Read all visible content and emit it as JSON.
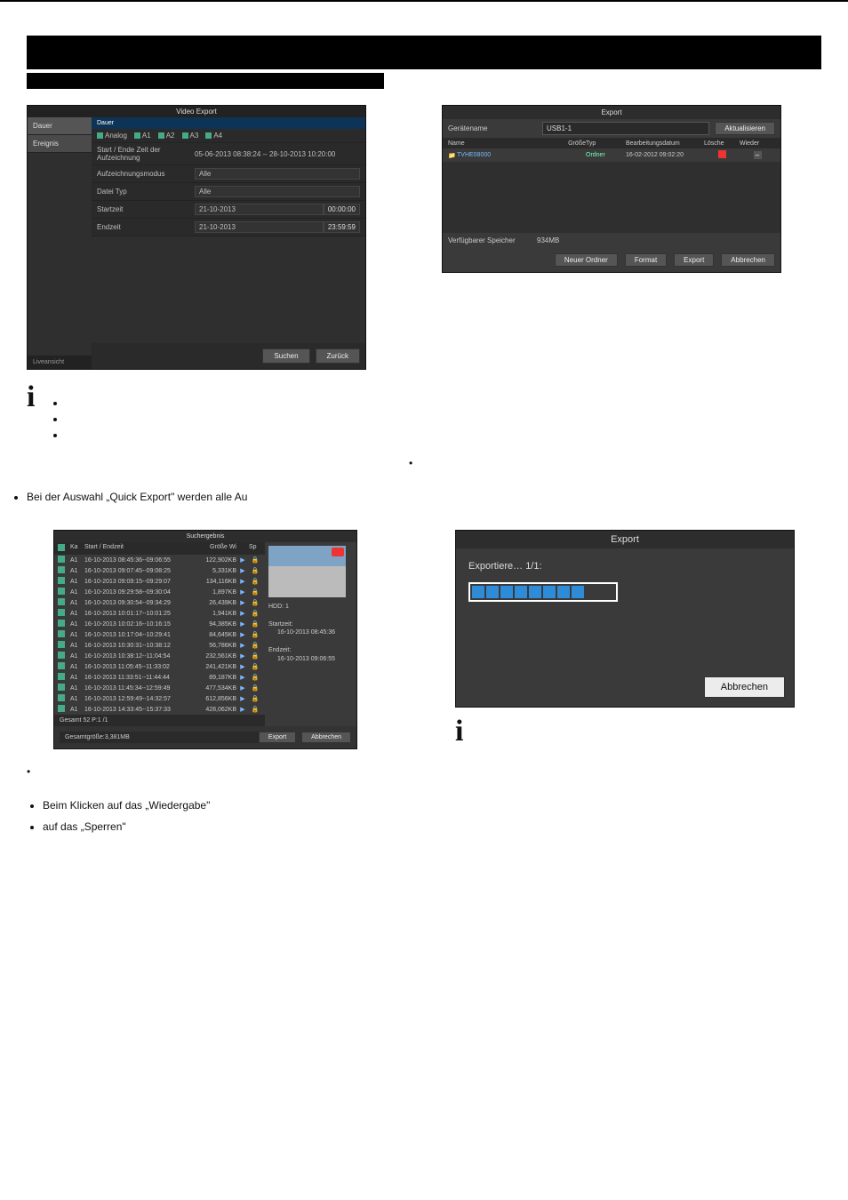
{
  "header": {},
  "video_export": {
    "title": "Video Export",
    "sidebar": {
      "tab_dauer": "Dauer",
      "tab_ereignis": "Ereignis",
      "live": "Liveansicht"
    },
    "top_tab": "Dauer",
    "rows": {
      "analog_label": "Analog",
      "channels": [
        "A1",
        "A2",
        "A3",
        "A4"
      ],
      "se_label": "Start / Ende Zeit der Aufzeichnung",
      "se_value": "05-06-2013 08:38:24  --  28-10-2013 10:20:00",
      "mode_label": "Aufzeichnungsmodus",
      "mode_value": "Alle",
      "type_label": "Datei Typ",
      "type_value": "Alle",
      "start_label": "Startzeit",
      "start_date": "21-10-2013",
      "start_time": "00:00:00",
      "end_label": "Endzeit",
      "end_date": "21-10-2013",
      "end_time": "23:59:59"
    },
    "buttons": {
      "search": "Suchen",
      "back": "Zurück"
    }
  },
  "export_dialog": {
    "title": "Export",
    "device_label": "Gerätename",
    "device_value": "USB1-1",
    "refresh": "Aktualisieren",
    "cols": {
      "name": "Name",
      "size": "Größe",
      "type": "Typ",
      "date": "Bearbeitungsdatum",
      "del": "Lösche",
      "play": "Wieder"
    },
    "row": {
      "name": "TVHE08000",
      "size": "",
      "type": "Ordner",
      "date": "16-02-2012 09:02:20"
    },
    "free_label": "Verfügbarer Speicher",
    "free_value": "934MB",
    "buttons": {
      "newfolder": "Neuer Ordner",
      "format": "Format",
      "export": "Export",
      "cancel": "Abbrechen"
    }
  },
  "notes": {
    "bullets": [
      "",
      "",
      ""
    ],
    "side_bullet": "",
    "quick_export": "Bei der Auswahl „Quick Export\" werden alle Au"
  },
  "search_result": {
    "title": "Suchergebnis",
    "cols": {
      "chk_all": "",
      "ka": "Ka",
      "time": "Start / Endzeit",
      "size": "Größe Wi",
      "sp": "Sp"
    },
    "rows": [
      {
        "ch": "A1",
        "t": "16-10-2013 08:45:36--09:06:55",
        "s": "122,902KB"
      },
      {
        "ch": "A1",
        "t": "16-10-2013 09:07:45--09:08:25",
        "s": "5,331KB"
      },
      {
        "ch": "A1",
        "t": "16-10-2013 09:09:15--09:29:07",
        "s": "134,116KB"
      },
      {
        "ch": "A1",
        "t": "16-10-2013 09:29:58--09:30:04",
        "s": "1,897KB"
      },
      {
        "ch": "A1",
        "t": "16-10-2013 09:30:54--09:34:29",
        "s": "26,439KB"
      },
      {
        "ch": "A1",
        "t": "16-10-2013 10:01:17--10:01:25",
        "s": "1,941KB"
      },
      {
        "ch": "A1",
        "t": "16-10-2013 10:02:16--10:16:15",
        "s": "94,385KB"
      },
      {
        "ch": "A1",
        "t": "16-10-2013 10:17:04--10:29:41",
        "s": "84,645KB"
      },
      {
        "ch": "A1",
        "t": "16-10-2013 10:30:31--10:38:12",
        "s": "56,786KB"
      },
      {
        "ch": "A1",
        "t": "16-10-2013 10:38:12--11:04:54",
        "s": "232,561KB"
      },
      {
        "ch": "A1",
        "t": "16-10-2013 11:05:45--11:33:02",
        "s": "241,421KB"
      },
      {
        "ch": "A1",
        "t": "16-10-2013 11:33:51--11:44:44",
        "s": "89,187KB"
      },
      {
        "ch": "A1",
        "t": "16-10-2013 11:45:34--12:59:49",
        "s": "477,534KB"
      },
      {
        "ch": "A1",
        "t": "16-10-2013 12:59:49--14:32:57",
        "s": "612,856KB"
      },
      {
        "ch": "A1",
        "t": "16-10-2013 14:33:45--15:37:33",
        "s": "428,062KB"
      }
    ],
    "page_total": "Gesamt 52 P:1 /1",
    "side": {
      "hdd": "HDD: 1",
      "start_label": "Startzeit:",
      "start": "16-10-2013 08:45:36",
      "end_label": "Endzeit:",
      "end": "16-10-2013 09:06:55"
    },
    "total": "Gesamtgröße:3,381MB",
    "buttons": {
      "export": "Export",
      "cancel": "Abbrechen"
    }
  },
  "progress": {
    "title": "Export",
    "label": "Exportiere… 1/1:",
    "cancel": "Abbrechen"
  },
  "trail": {
    "line1": "Beim Klicken auf das „Wiedergabe\"",
    "line2": "auf das „Sperren\""
  }
}
